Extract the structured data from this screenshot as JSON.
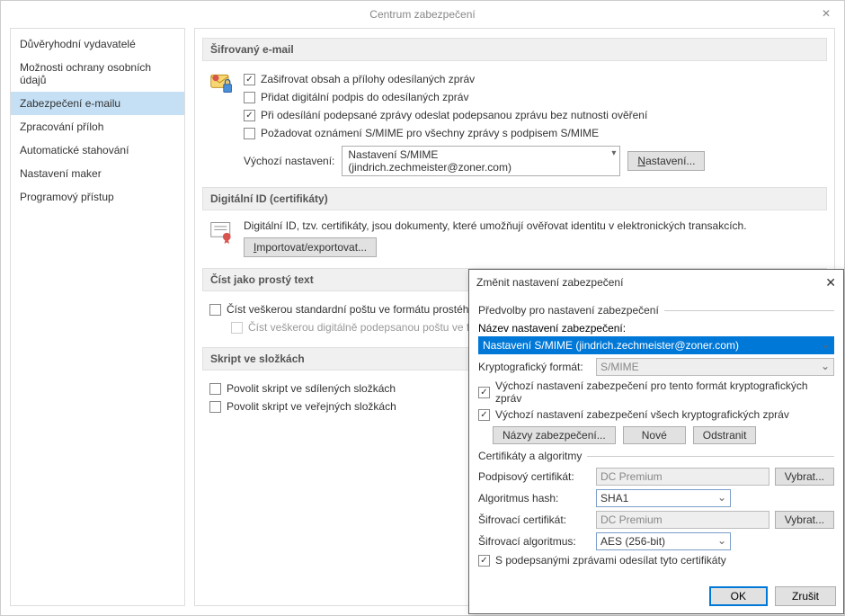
{
  "window": {
    "title": "Centrum zabezpečení"
  },
  "sidebar": {
    "items": [
      {
        "label": "Důvěryhodní vydavatelé"
      },
      {
        "label": "Možnosti ochrany osobních údajů"
      },
      {
        "label": "Zabezpečení e-mailu"
      },
      {
        "label": "Zpracování příloh"
      },
      {
        "label": "Automatické stahování"
      },
      {
        "label": "Nastavení maker"
      },
      {
        "label": "Programový přístup"
      }
    ]
  },
  "sections": {
    "encrypted": {
      "header": "Šifrovaný e-mail",
      "cb_encrypt": "Zašifrovat obsah a přílohy odesílaných zpráv",
      "cb_sign": "Přidat digitální podpis do odesílaných zpráv",
      "cb_cleartext": "Při odesílání podepsané zprávy odeslat podepsanou zprávu bez nutnosti ověření",
      "cb_receipt": "Požadovat oznámení S/MIME pro všechny zprávy s podpisem S/MIME",
      "default_label": "Výchozí nastavení:",
      "default_value": "Nastavení S/MIME (jindrich.zechmeister@zoner.com)",
      "settings_btn": "Nastavení..."
    },
    "digitalid": {
      "header": "Digitální ID (certifikáty)",
      "desc": "Digitální ID, tzv. certifikáty, jsou dokumenty, které umožňují ověřovat identitu v elektronických transakcích.",
      "import_btn": "Importovat/exportovat..."
    },
    "plaintext": {
      "header": "Číst jako prostý text",
      "cb_all": "Číst veškerou standardní poštu ve formátu prostého textu",
      "cb_signed": "Číst veškerou digitálně podepsanou poštu ve formátu prostého textu"
    },
    "scripts": {
      "header": "Skript ve složkách",
      "cb_shared": "Povolit skript ve sdílených složkách",
      "cb_public": "Povolit skript ve veřejných složkách"
    }
  },
  "dialog": {
    "title": "Změnit nastavení zabezpečení",
    "group_prefs": "Předvolby pro nastavení zabezpečení",
    "name_label": "Název nastavení zabezpečení:",
    "name_value": "Nastavení S/MIME (jindrich.zechmeister@zoner.com)",
    "crypto_label": "Kryptografický formát:",
    "crypto_value": "S/MIME",
    "cb_default_format": "Výchozí nastavení zabezpečení pro tento formát kryptografických zpráv",
    "cb_default_all": "Výchozí nastavení zabezpečení všech kryptografických zpráv",
    "btn_labels": "Názvy zabezpečení...",
    "btn_new": "Nové",
    "btn_delete": "Odstranit",
    "group_certs": "Certifikáty a algoritmy",
    "sign_cert_label": "Podpisový certifikát:",
    "sign_cert_value": "DC Premium",
    "hash_label": "Algoritmus hash:",
    "hash_value": "SHA1",
    "enc_cert_label": "Šifrovací certifikát:",
    "enc_cert_value": "DC Premium",
    "enc_alg_label": "Šifrovací algoritmus:",
    "enc_alg_value": "AES (256-bit)",
    "btn_choose": "Vybrat...",
    "cb_send_certs": "S podepsanými zprávami odesílat tyto certifikáty",
    "ok": "OK",
    "cancel": "Zrušit"
  }
}
